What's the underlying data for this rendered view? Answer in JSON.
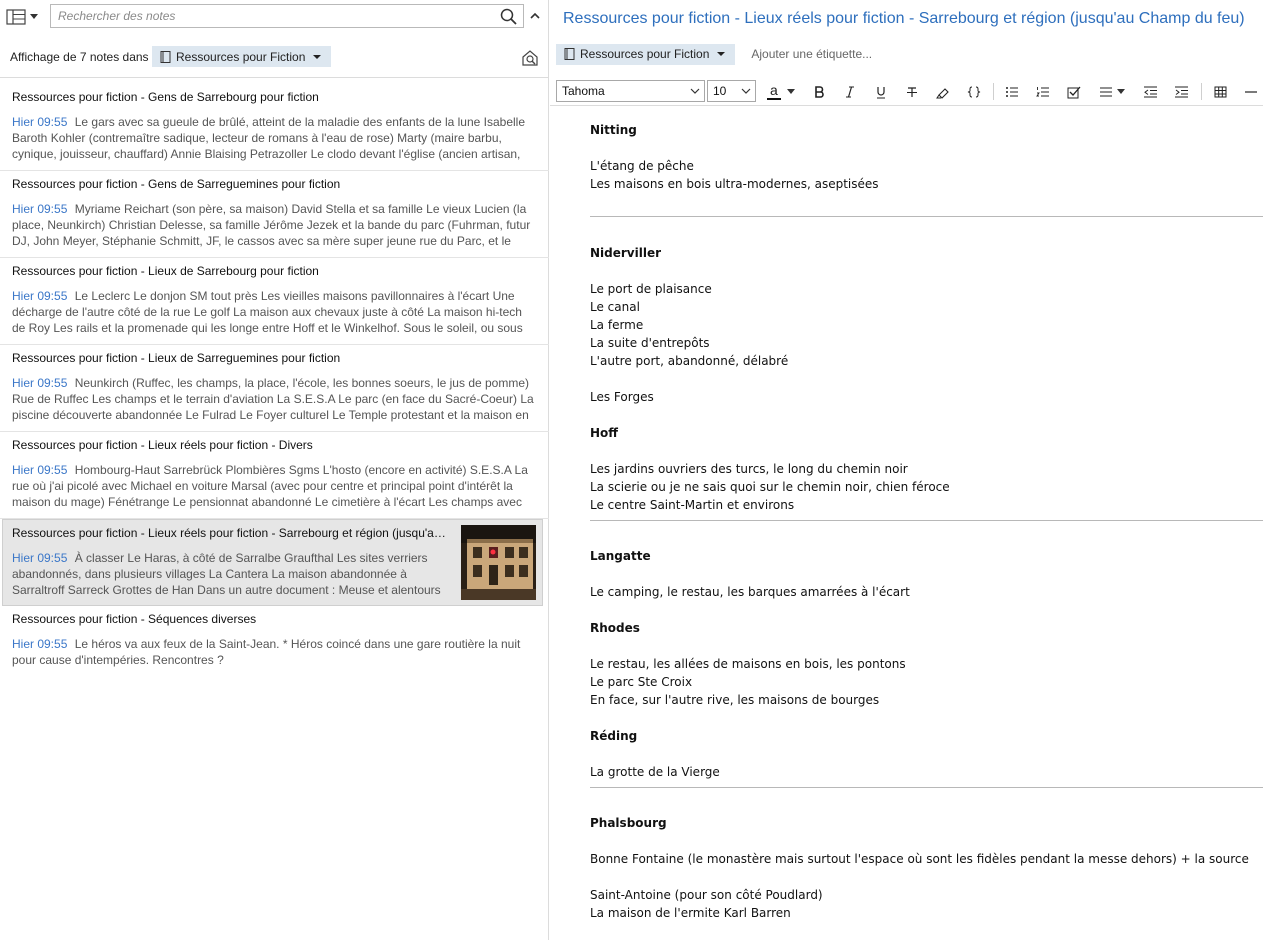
{
  "search": {
    "placeholder": "Rechercher des notes"
  },
  "filter": {
    "label": "Affichage de 7 notes dans",
    "notebook": "Ressources pour Fiction"
  },
  "notes": [
    {
      "title": "Ressources pour fiction - Gens de Sarrebourg pour fiction",
      "date": "Hier 09:55",
      "snippet": "Le gars avec sa gueule de brûlé, atteint de la maladie des enfants de la lune Isabelle Baroth Kohler (contremaître sadique, lecteur de romans à l'eau de rose) Marty (maire barbu, cynique, jouisseur, chauffard) Annie Blaising Petrazoller Le clodo devant l'église (ancien artisan, d..."
    },
    {
      "title": "Ressources pour fiction - Gens de Sarreguemines pour fiction",
      "date": "Hier 09:55",
      "snippet": "Myriame Reichart (son père, sa maison) David Stella et sa famille Le vieux Lucien (la place, Neunkirch) Christian Delesse, sa famille Jérôme Jezek et la bande du parc (Fuhrman, futur DJ, John Meyer, Stéphanie Schmitt, JF, le cassos avec sa mère super jeune rue du Parc, et le turc) ..."
    },
    {
      "title": "Ressources pour fiction - Lieux de Sarrebourg pour fiction",
      "date": "Hier 09:55",
      "snippet": "Le Leclerc Le donjon SM tout près Les vieilles maisons pavillonnaires à l'écart Une décharge de l'autre côté de la rue Le golf La maison aux chevaux juste à côté La maison hi-tech de Roy Les rails et la promenade qui les longe entre Hoff et le Winkelhof. Sous le soleil, ou sous la ne..."
    },
    {
      "title": "Ressources pour fiction - Lieux de Sarreguemines pour fiction",
      "date": "Hier 09:55",
      "snippet": "Neunkirch (Ruffec, les champs, la place, l'école, les bonnes soeurs, le jus de pomme) Rue de Ruffec Les champs et le terrain d'aviation La S.E.S.A Le parc (en face du Sacré-Coeur) La piscine découverte abandonnée Le Fulrad Le Foyer culturel Le Temple protestant et la maison en ..."
    },
    {
      "title": "Ressources pour fiction - Lieux réels pour fiction - Divers",
      "date": "Hier 09:55",
      "snippet": "Hombourg-Haut Sarrebrück Plombières Sgms L'hosto (encore en activité) S.E.S.A La rue où j'ai picolé avec Michael en voiture Marsal (avec pour centre et principal point d'intérêt la maison du mage) Fénétrange Le pensionnat abandonné Le cimetière à l'écart Les champs avec le..."
    },
    {
      "title": "Ressources pour fiction - Lieux réels pour fiction - Sarrebourg et région (jusqu'au Champ du feu)",
      "date": "Hier 09:55",
      "snippet": "À classer Le Haras, à côté de Sarralbe Graufthal Les sites verriers abandonnés, dans plusieurs villages La Cantera La maison abandonnée à Sarraltroff Sarreck Grottes de Han Dans un autre document : Meuse et alentours Sommevoir..."
    },
    {
      "title": "Ressources pour fiction - Séquences diverses",
      "date": "Hier 09:55",
      "snippet": "Le héros va aux feux de la Saint-Jean. * Héros coincé dans une gare routière la nuit pour cause d'intempéries. Rencontres ?"
    }
  ],
  "editor": {
    "title": "Ressources pour fiction - Lieux réels pour fiction - Sarrebourg et région (jusqu'au Champ du feu)",
    "notebook": "Ressources pour Fiction",
    "add_tag": "Ajouter une étiquette...",
    "font": "Tahoma",
    "size": "10",
    "text_color_glyph": "a",
    "sections": {
      "nitting": {
        "title": "Nitting",
        "lines": [
          "L'étang de pêche",
          "Les maisons en bois ultra-modernes, aseptisées"
        ]
      },
      "niderviller": {
        "title": "Niderviller",
        "lines": [
          "Le port de plaisance",
          "Le canal",
          "La ferme",
          "La suite d'entrepôts",
          "L'autre port, abandonné, délabré",
          "Les Forges"
        ]
      },
      "hoff": {
        "title": "Hoff",
        "lines": [
          "Les jardins ouvriers des turcs, le long du chemin noir",
          "La scierie ou je ne sais quoi sur le chemin noir, chien féroce",
          "Le centre Saint-Martin et environs"
        ]
      },
      "langatte": {
        "title": "Langatte",
        "lines": [
          "Le camping, le restau, les barques amarrées à l'écart"
        ]
      },
      "rhodes": {
        "title": "Rhodes",
        "lines": [
          "Le restau, les allées de maisons en bois, les pontons",
          "Le parc Ste Croix",
          "En face, sur l'autre rive, les maisons de bourges"
        ]
      },
      "reding": {
        "title": "Réding",
        "lines": [
          "La grotte de la Vierge"
        ]
      },
      "phalsbourg": {
        "title": "Phalsbourg",
        "lines": [
          "Bonne Fontaine (le monastère mais surtout l'espace où sont les fidèles pendant la messe dehors) + la source",
          "Saint-Antoine (pour son côté Poudlard)",
          "La maison de l'ermite Karl Barren"
        ]
      }
    }
  },
  "colors": {
    "accent": "#2e6fbd",
    "date": "#3b77c8",
    "chip": "#dde7f0",
    "selected_bg": "#e6e6e6"
  }
}
